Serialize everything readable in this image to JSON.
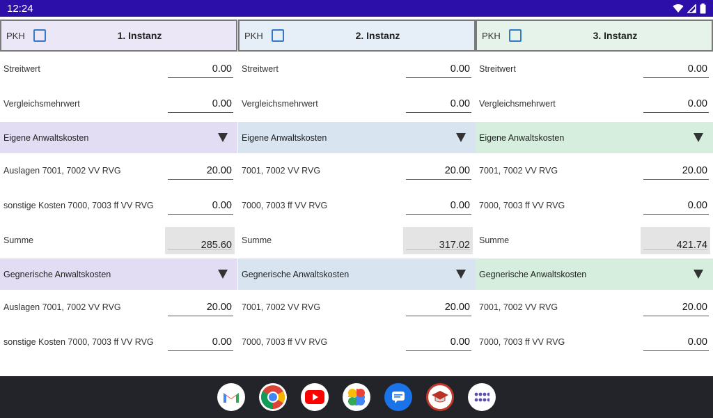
{
  "status": {
    "time": "12:24"
  },
  "columns": [
    {
      "pkh": "PKH",
      "title": "1. Instanz",
      "header_bg": "#ebe7f7",
      "section_bg": "#e3ddf3",
      "streitwert_label": "Streitwert",
      "streitwert_value": "0.00",
      "vergleich_label": "Vergleichsmehrwert",
      "vergleich_value": "0.00",
      "eigene_label": "Eigene Anwaltskosten",
      "auslagen_label": "Auslagen 7001, 7002 VV RVG",
      "auslagen_value": "20.00",
      "sonstige_label": "sonstige Kosten 7000, 7003 ff VV RVG",
      "sonstige_value": "0.00",
      "summe_label": "Summe",
      "summe_value": "285.60",
      "gegner_label": "Gegnerische Anwaltskosten",
      "g_auslagen_label": "Auslagen 7001, 7002 VV RVG",
      "g_auslagen_value": "20.00",
      "g_sonstige_label": "sonstige Kosten 7000, 7003 ff VV RVG",
      "g_sonstige_value": "0.00"
    },
    {
      "pkh": "PKH",
      "title": "2. Instanz",
      "header_bg": "#e6eef7",
      "section_bg": "#d8e5f1",
      "streitwert_label": "Streitwert",
      "streitwert_value": "0.00",
      "vergleich_label": "Vergleichsmehrwert",
      "vergleich_value": "0.00",
      "eigene_label": "Eigene Anwaltskosten",
      "auslagen_label": "7001, 7002 VV RVG",
      "auslagen_value": "20.00",
      "sonstige_label": "7000, 7003 ff VV RVG",
      "sonstige_value": "0.00",
      "summe_label": "Summe",
      "summe_value": "317.02",
      "gegner_label": "Gegnerische Anwaltskosten",
      "g_auslagen_label": "7001, 7002 VV RVG",
      "g_auslagen_value": "20.00",
      "g_sonstige_label": "7000, 7003 ff VV RVG",
      "g_sonstige_value": "0.00"
    },
    {
      "pkh": "PKH",
      "title": "3. Instanz",
      "header_bg": "#e5f3ea",
      "section_bg": "#d6eede",
      "streitwert_label": "Streitwert",
      "streitwert_value": "0.00",
      "vergleich_label": "Vergleichsmehrwert",
      "vergleich_value": "0.00",
      "eigene_label": "Eigene Anwaltskosten",
      "auslagen_label": "7001, 7002 VV RVG",
      "auslagen_value": "20.00",
      "sonstige_label": "7000, 7003 ff VV RVG",
      "sonstige_value": "0.00",
      "summe_label": "Summe",
      "summe_value": "421.74",
      "gegner_label": "Gegnerische Anwaltskosten",
      "g_auslagen_label": "7001, 7002 VV RVG",
      "g_auslagen_value": "20.00",
      "g_sonstige_label": "7000, 7003 ff VV RVG",
      "g_sonstige_value": "0.00"
    }
  ],
  "dock": [
    "gmail-icon",
    "chrome-icon",
    "youtube-icon",
    "photos-icon",
    "messages-icon",
    "law-app-icon",
    "app-drawer-icon"
  ]
}
